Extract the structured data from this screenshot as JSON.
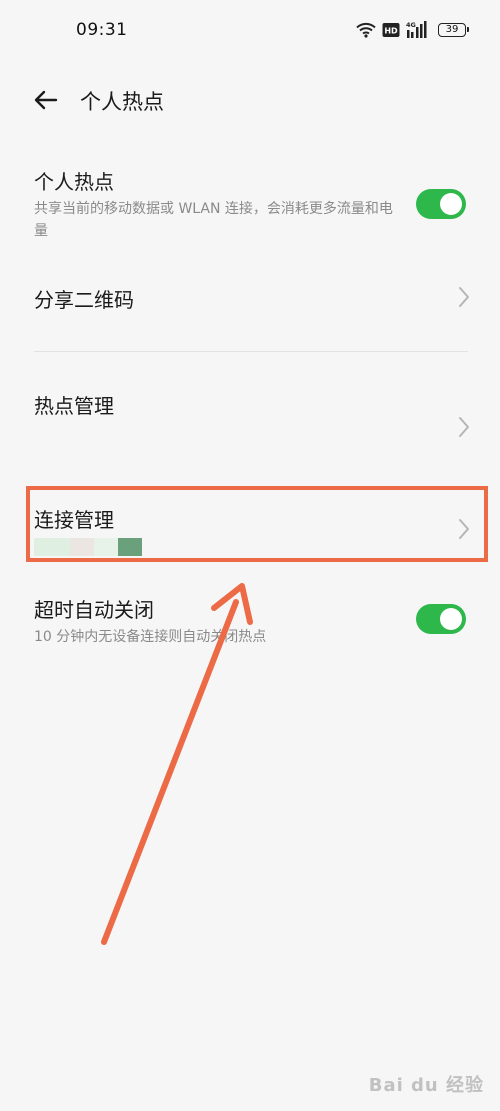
{
  "status_bar": {
    "time": "09:31",
    "battery": "39",
    "hd_label": "HD",
    "network_label": "4G"
  },
  "header": {
    "title": "个人热点"
  },
  "rows": {
    "hotspot": {
      "title": "个人热点",
      "subtitle": "共享当前的移动数据或 WLAN 连接，会消耗更多流量和电量",
      "toggle_on": true
    },
    "share_qr": {
      "title": "分享二维码"
    },
    "hotspot_manage": {
      "title": "热点管理"
    },
    "connection_manage": {
      "title": "连接管理"
    },
    "auto_off": {
      "title": "超时自动关闭",
      "subtitle": "10 分钟内无设备连接则自动关闭热点",
      "toggle_on": true
    }
  },
  "watermark": "Bai du 经验",
  "colors": {
    "toggle_on": "#2eb84c",
    "annotation": "#ec6a45",
    "background": "#f6f6f6"
  },
  "icons": {
    "back": "back-arrow-icon",
    "chevron": "chevron-right-icon",
    "wifi": "wifi-icon",
    "signal": "signal-icon",
    "battery": "battery-icon"
  }
}
